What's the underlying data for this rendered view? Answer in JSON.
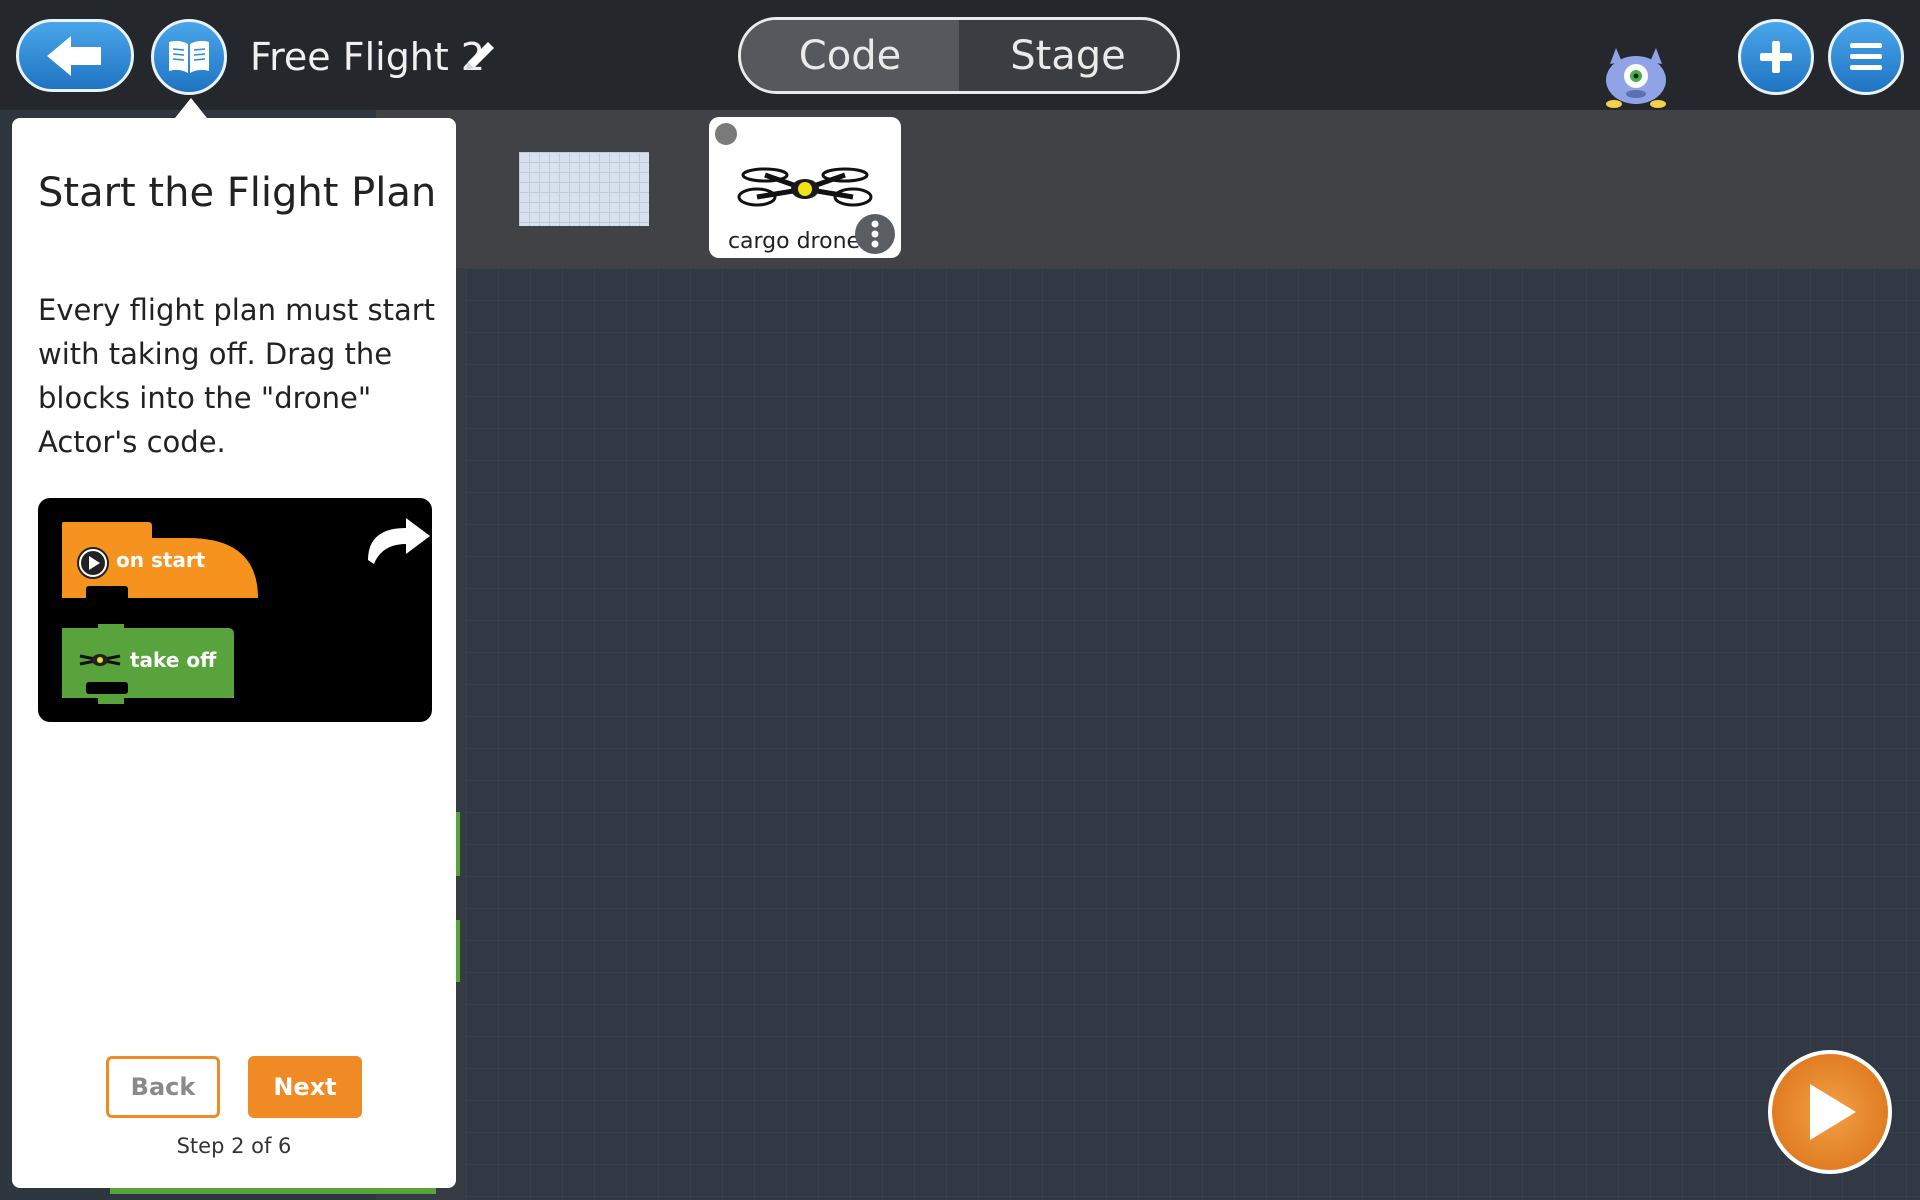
{
  "topbar": {
    "project_title": "Free Flight 2",
    "tabs": [
      {
        "label": "Code",
        "active": true
      },
      {
        "label": "Stage",
        "active": false
      }
    ]
  },
  "actors": [
    {
      "name": "cargo drone",
      "icon": "drone-icon"
    }
  ],
  "tutorial": {
    "title": "Start the Flight Plan",
    "body": "Every flight plan must start with taking off. Drag the blocks into the \"drone\" Actor's code.",
    "blocks": {
      "on_start_label": "on start",
      "take_off_label": "take off"
    },
    "back_label": "Back",
    "next_label": "Next",
    "step_text": "Step 2 of 6"
  },
  "colors": {
    "accent_blue": "#2f8ad6",
    "accent_orange": "#f08a24",
    "event_block": "#f6931e",
    "motion_block": "#58a33c"
  }
}
